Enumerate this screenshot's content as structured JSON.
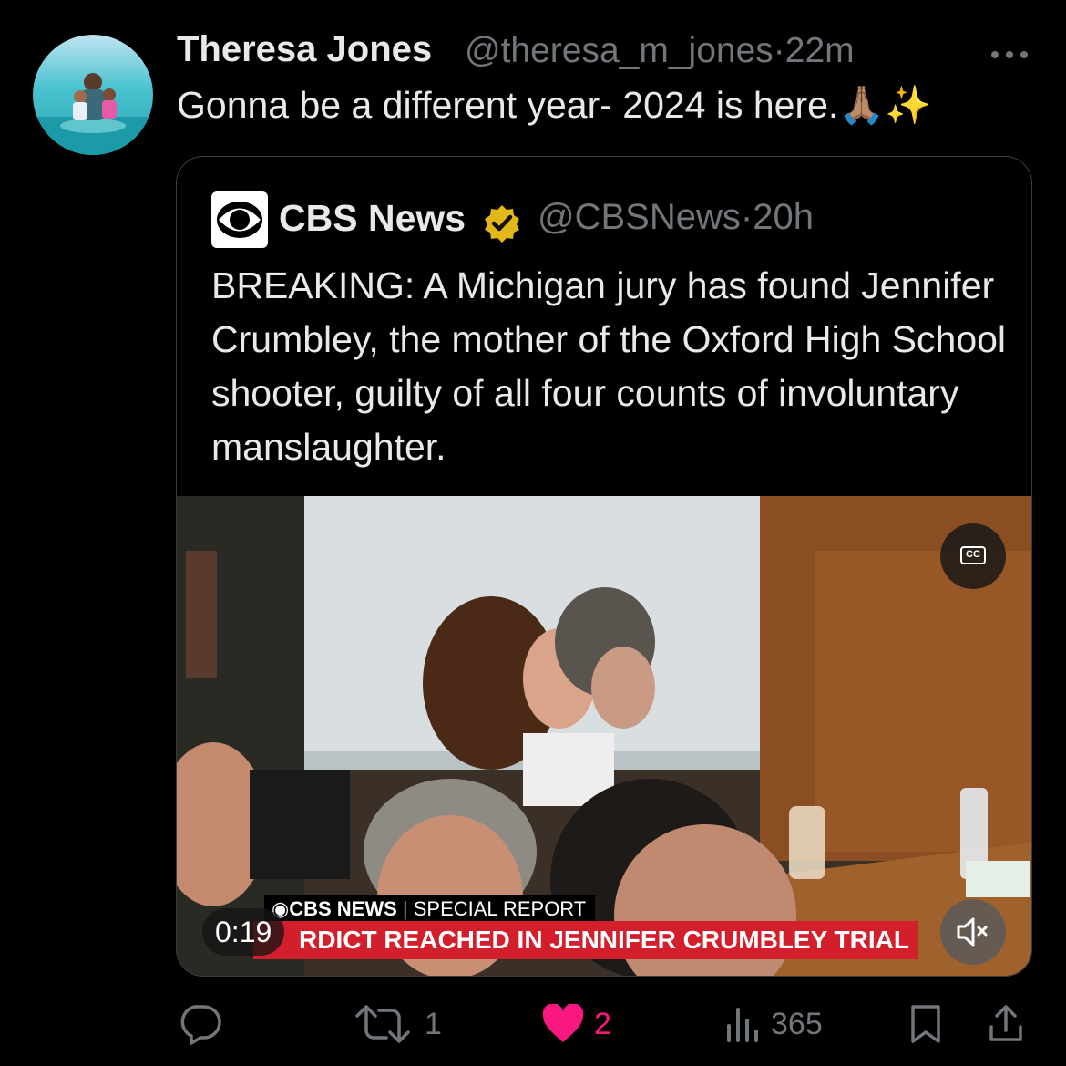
{
  "tweet": {
    "author_name": "Theresa Jones",
    "author_handle": "@theresa_m_jones",
    "separator": "·",
    "time": "22m",
    "text": "Gonna be a different year- 2024 is here.",
    "emoji": "🙏🏽✨"
  },
  "quoted": {
    "author_name": "CBS News",
    "author_handle": "@CBSNews",
    "time": "20h",
    "text": "BREAKING: A Michigan jury has found Jennifer Crumbley, the mother of the Oxford High School shooter, guilty of all four counts of involuntary manslaughter.",
    "video": {
      "cc_label": "CC",
      "chyron_brand": "CBS NEWS",
      "chyron_tag": "SPECIAL REPORT",
      "chyron_headline": "RDICT REACHED IN JENNIFER CRUMBLEY TRIAL",
      "timestamp": "0:19"
    }
  },
  "actions": {
    "retweets": "1",
    "likes": "2",
    "views": "365"
  },
  "colors": {
    "background": "#000000",
    "text": "#e7e9ea",
    "muted": "#71767b",
    "like": "#f91880",
    "verified_gold": "#e2b719",
    "chyron_red": "#d21f2b"
  },
  "icons": [
    "more-icon",
    "verified-badge-icon",
    "cc-icon",
    "mute-icon",
    "reply-icon",
    "retweet-icon",
    "like-icon",
    "views-icon",
    "bookmark-icon",
    "share-icon"
  ]
}
